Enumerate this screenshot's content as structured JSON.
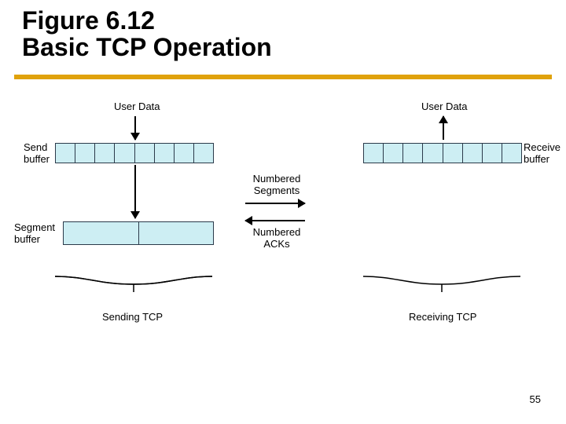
{
  "title": {
    "line1": "Figure 6.12",
    "line2": "Basic TCP Operation"
  },
  "labels": {
    "user_data_left": "User Data",
    "user_data_right": "User Data",
    "send_buffer": "Send\nbuffer",
    "receive_buffer": "Receive\nbuffer",
    "segment_buffer": "Segment\nbuffer",
    "numbered_segments": "Numbered\nSegments",
    "numbered_acks": "Numbered\nACKs",
    "sending_tcp": "Sending TCP",
    "receiving_tcp": "Receiving TCP"
  },
  "page_number": "55",
  "diagram": {
    "send_buffer_cells": 8,
    "receive_buffer_cells": 8,
    "segment_buffer_segments": 2
  }
}
